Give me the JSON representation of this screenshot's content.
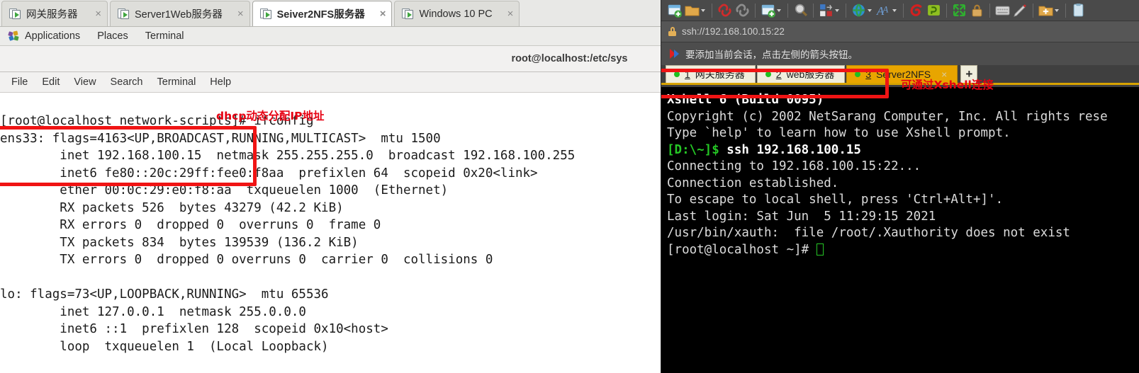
{
  "vmware": {
    "tabs": [
      {
        "label": "网关服务器",
        "active": false,
        "icon": "vm-icon",
        "close": "×"
      },
      {
        "label": "Server1Web服务器",
        "active": false,
        "icon": "vm-icon",
        "close": "×"
      },
      {
        "label": "Seiver2NFS服务器",
        "active": true,
        "icon": "vm-icon",
        "close": "×"
      },
      {
        "label": "Windows 10 PC",
        "active": false,
        "icon": "vm-icon",
        "close": "×"
      }
    ]
  },
  "gnome_panel": {
    "apps_icon": "applications-icon",
    "items": [
      "Applications",
      "Places",
      "Terminal"
    ]
  },
  "terminal_window": {
    "title": "root@localhost:/etc/sys",
    "menu": [
      "File",
      "Edit",
      "View",
      "Search",
      "Terminal",
      "Help"
    ],
    "lines": [
      "[root@localhost network-scripts]# ifconfig",
      "ens33: flags=4163<UP,BROADCAST,RUNNING,MULTICAST>  mtu 1500",
      "        inet 192.168.100.15  netmask 255.255.255.0  broadcast 192.168.100.255",
      "        inet6 fe80::20c:29ff:fee0:f8aa  prefixlen 64  scopeid 0x20<link>",
      "        ether 00:0c:29:e0:f8:aa  txqueuelen 1000  (Ethernet)",
      "        RX packets 526  bytes 43279 (42.2 KiB)",
      "        RX errors 0  dropped 0  overruns 0  frame 0",
      "        TX packets 834  bytes 139539 (136.2 KiB)",
      "        TX errors 0  dropped 0 overruns 0  carrier 0  collisions 0",
      "",
      "lo: flags=73<UP,LOOPBACK,RUNNING>  mtu 65536",
      "        inet 127.0.0.1  netmask 255.0.0.0",
      "        inet6 ::1  prefixlen 128  scopeid 0x10<host>",
      "        loop  txqueuelen 1  (Local Loopback)"
    ]
  },
  "annotations": {
    "dhcp_caption": "dhcp动态分配IP地址",
    "xshell_caption": "可通过Xshell连接",
    "box_color": "#f01414",
    "text_color": "#e60012"
  },
  "xshell": {
    "toolbar": [
      {
        "name": "new-session-icon",
        "caret": false
      },
      {
        "name": "open-folder-icon",
        "caret": true
      },
      {
        "name": "disconnect-icon",
        "caret": false
      },
      {
        "name": "reconnect-icon",
        "caret": false
      },
      {
        "name": "session-properties-icon",
        "caret": true
      },
      {
        "name": "find-icon",
        "caret": false
      },
      {
        "name": "color-scheme-icon",
        "caret": true
      },
      {
        "name": "globe-transfer-icon",
        "caret": true
      },
      {
        "name": "font-size-icon",
        "caret": true
      },
      {
        "name": "compose-bar-icon",
        "caret": false
      },
      {
        "name": "highlight-icon",
        "caret": false
      },
      {
        "name": "arrange-windows-icon",
        "caret": false
      },
      {
        "name": "lock-icon",
        "caret": false
      },
      {
        "name": "keyboard-icon",
        "caret": false
      },
      {
        "name": "log-icon",
        "caret": false
      },
      {
        "name": "add-folder-icon",
        "caret": true
      },
      {
        "name": "clipboard-icon",
        "caret": false
      }
    ],
    "address": "ssh://192.168.100.15:22",
    "address_lock_icon": "lock-icon",
    "notice": "要添加当前会话，点击左侧的箭头按钮。",
    "notice_icon": "arrow-notice-icon",
    "tabs": [
      {
        "num": "1",
        "label": "网关服务器",
        "active": false,
        "status": "connected"
      },
      {
        "num": "2",
        "label": "web服务器",
        "active": false,
        "status": "connected"
      },
      {
        "num": "3",
        "label": "Server2NFS",
        "active": true,
        "status": "connected",
        "close": "×"
      }
    ],
    "new_tab_label": "+",
    "terminal": {
      "lines": [
        {
          "text": "Xshell 6 (Build 0095)",
          "style": "bold"
        },
        {
          "text": "Copyright (c) 2002 NetSarang Computer, Inc. All rights rese",
          "style": "normal"
        },
        {
          "text": "",
          "style": "normal"
        },
        {
          "text": "Type `help' to learn how to use Xshell prompt.",
          "style": "normal"
        },
        {
          "text": "",
          "style": "prompt_local"
        },
        {
          "text": "",
          "style": "normal"
        },
        {
          "text": "Connecting to 192.168.100.15:22...",
          "style": "normal"
        },
        {
          "text": "Connection established.",
          "style": "normal"
        },
        {
          "text": "To escape to local shell, press 'Ctrl+Alt+]'.",
          "style": "normal"
        },
        {
          "text": "",
          "style": "normal"
        },
        {
          "text": "Last login: Sat Jun  5 11:29:15 2021",
          "style": "normal"
        },
        {
          "text": "/usr/bin/xauth:  file /root/.Xauthority does not exist",
          "style": "normal"
        },
        {
          "text": "",
          "style": "prompt_remote"
        }
      ],
      "local_prompt": "[D:\\~]$",
      "local_command": " ssh 192.168.100.15",
      "remote_prompt": "[root@localhost ~]# ",
      "prompt_color": "#25c625"
    }
  }
}
